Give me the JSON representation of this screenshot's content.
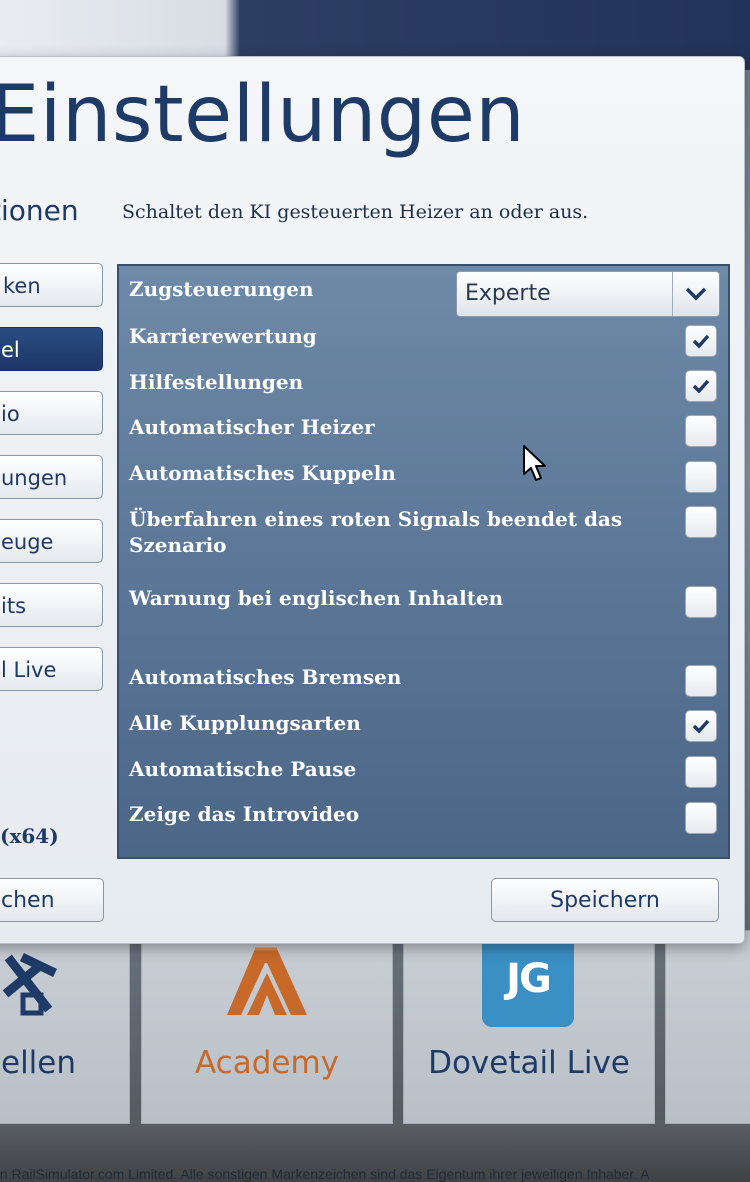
{
  "dialog": {
    "title": "Einstellungen",
    "section_label": "tionen",
    "description": "Schaltet den KI gesteuerten Heizer an oder aus."
  },
  "sidebar": {
    "items": [
      {
        "label": "ken",
        "active": false
      },
      {
        "label": "el",
        "active": true
      },
      {
        "label": "io",
        "active": false
      },
      {
        "label": "ungen",
        "active": false
      },
      {
        "label": "euge",
        "active": false
      },
      {
        "label": "its",
        "active": false
      },
      {
        "label": "l Live",
        "active": false
      }
    ],
    "version": "(x64)"
  },
  "buttons": {
    "left_label": "chen",
    "save_label": "Speichern"
  },
  "settings": {
    "dropdown_label": "Zugsteuerungen",
    "dropdown_value": "Experte",
    "options": [
      {
        "label": "Karrierewertung",
        "checked": true
      },
      {
        "label": "Hilfestellungen",
        "checked": true
      },
      {
        "label": "Automatischer Heizer",
        "checked": false
      },
      {
        "label": "Automatisches Kuppeln",
        "checked": false
      },
      {
        "label": "Überfahren eines roten Signals beendet das",
        "label2": "Szenario",
        "checked": false
      },
      {
        "label": "Warnung bei englischen Inhalten",
        "checked": false
      },
      {
        "label": "Automatisches Bremsen",
        "checked": false
      },
      {
        "label": "Alle Kupplungsarten",
        "checked": true
      },
      {
        "label": "Automatische Pause",
        "checked": false
      },
      {
        "label": "Zeige das Introvideo",
        "checked": false
      }
    ]
  },
  "tiles": {
    "tile1_label": "ellen",
    "tile2_label": "Academy",
    "tile3_label": "Dovetail Live",
    "tile3_logo": "JG"
  },
  "footer": {
    "copyright": "on RailSimulator.com Limited. Alle sonstigen Markenzeichen sind das Eigentum ihrer jeweiligen Inhaber. A"
  },
  "colors": {
    "brand_blue": "#1e3a66",
    "academy_orange": "#c8692a",
    "dovetail_blue": "#3a8fc4",
    "panel_blue": "#5c7797"
  }
}
